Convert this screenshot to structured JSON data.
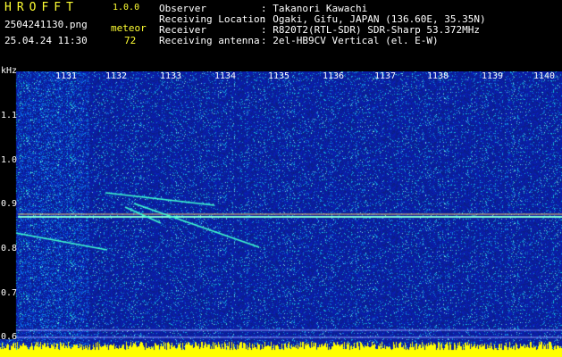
{
  "header": {
    "app_name": "HROFFT",
    "version": "1.0.0",
    "filename": "2504241130.png",
    "datetime": "25.04.24 11:30",
    "meteor_label": "meteor",
    "meteor_count": "72",
    "fields": [
      {
        "label": "Observer",
        "value": ": Takanori Kawachi"
      },
      {
        "label": "Receiving Location",
        "value": ": Ogaki, Gifu, JAPAN (136.60E, 35.35N)"
      },
      {
        "label": "Receiver",
        "value": ": R820T2(RTL-SDR) SDR-Sharp 53.372MHz"
      },
      {
        "label": "Receiving antenna",
        "value": ": 2el-HB9CV Vertical (el. E-W)"
      }
    ]
  },
  "spectrogram": {
    "unit_label": "kHz",
    "time_ticks": [
      "1131",
      "1132",
      "1133",
      "1134",
      "1135",
      "1136",
      "1137",
      "1138",
      "1139",
      "1140"
    ],
    "freq_ticks": [
      "1.1",
      "1.0",
      "0.9",
      "0.8",
      "0.7",
      "0.6"
    ],
    "colors": {
      "background": "#0b1e8a",
      "carrier": "#7fffd4",
      "floor": "#ffff00"
    }
  }
}
